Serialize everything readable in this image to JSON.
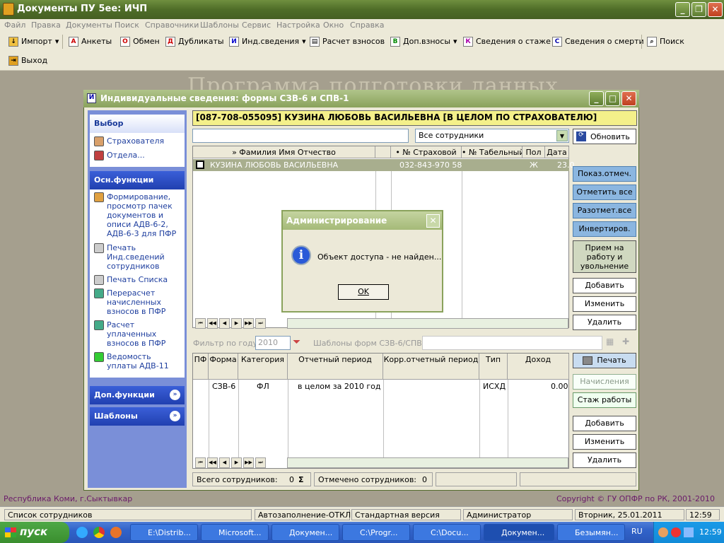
{
  "app": {
    "title": "Документы ПУ 5ее: ИЧП"
  },
  "menu": [
    "Файл",
    "Правка",
    "Документы",
    "Поиск",
    "Справочники",
    "Шаблоны",
    "Сервис",
    "Настройка",
    "Окно",
    "Справка"
  ],
  "toolbar": {
    "import": "Импорт",
    "ankety": "Анкеты",
    "obmen": "Обмен",
    "dublikaty": "Дубликаты",
    "ind": "Инд.сведения",
    "raschet": "Расчет взносов",
    "dopvz": "Доп.взносы",
    "stazh": "Сведения о стаже",
    "smerti": "Сведения о смерти",
    "poisk": "Поиск",
    "exit": "Выход"
  },
  "bgtext": "Программа подготовки данных",
  "window": {
    "title": "Индивидуальные сведения: формы СЗВ-6 и СПВ-1",
    "header": "[087-708-055095] КУЗИНА ЛЮБОВЬ ВАСИЛЬЕВНА [В ЦЕЛОМ ПО СТРАХОВАТЕЛЮ]",
    "filter_select": "Все сотрудники",
    "refresh": "Обновить"
  },
  "sidebar": {
    "vybor": "Выбор",
    "strah": "Страхователя",
    "otdela": "Отдела...",
    "osn": "Осн.функции",
    "f1": "Формирование, просмотр пачек документов и описи АДВ-6-2, АДВ-6-3 для ПФР",
    "f2": "Печать Инд.сведений сотрудников",
    "f3": "Печать Списка",
    "f4": "Перерасчет начисленных взносов в ПФР",
    "f5": "Расчет уплаченных взносов в ПФР",
    "f6": "Ведомость уплаты АДВ-11",
    "dop": "Доп.функции",
    "shabl": "Шаблоны"
  },
  "grid1": {
    "headers": [
      "» Фамилия Имя Отчество",
      "• № Страховой",
      "• № Табельный",
      "Пол",
      "Дата"
    ],
    "row": {
      "name": "КУЗИНА ЛЮБОВЬ ВАСИЛЬЕВНА",
      "snils": "032-843-970 58",
      "tab": "",
      "sex": "Ж",
      "date": "23.0"
    }
  },
  "right1": [
    "Показ.отмеч.",
    "Отметить все",
    "Разотмет.все",
    "Инвертиров.",
    "Прием на работу и увольнение",
    "Добавить",
    "Изменить",
    "Удалить"
  ],
  "filter": {
    "label": "Фильтр по году:",
    "year": "2010",
    "templates": "Шаблоны форм СЗВ-6/СПВ-1:"
  },
  "grid2": {
    "headers": [
      "ПФ",
      "Форма",
      "Категория",
      "Отчетный период",
      "Корр.отчетный период",
      "Тип",
      "Доход"
    ],
    "row": {
      "pf": "",
      "form": "СЗВ-6",
      "cat": "ФЛ",
      "period": "в целом за 2010 год",
      "corr": "",
      "type": "ИСХД",
      "income": "0.00"
    }
  },
  "right2": [
    "Печать",
    "Начисления",
    "Стаж работы",
    "Добавить",
    "Изменить",
    "Удалить"
  ],
  "bottom": {
    "total_label": "Всего сотрудников:",
    "total": "0",
    "sigma": "Σ",
    "marked_label": "Отмечено сотрудников:",
    "marked": "0"
  },
  "dialog": {
    "title": "Администрирование",
    "message": "Объект доступа - не найден...",
    "ok": "OK"
  },
  "footer": {
    "left": "Республика Коми, г.Сыктывкар",
    "right": "Copyright © ГУ ОПФР по РК, 2001-2010"
  },
  "status": [
    "Список сотрудников",
    "Автозаполнение-ОТКЛ",
    "Стандартная версия",
    "Администратор",
    "Вторник, 25.01.2011",
    "12:59"
  ],
  "taskbar": {
    "start": "пуск",
    "tasks": [
      "E:\\Distrib...",
      "Microsoft...",
      "Докумен...",
      "C:\\Progr...",
      "C:\\Docu...",
      "Докумен...",
      "Безымян..."
    ],
    "lang": "RU",
    "clock": "12:59"
  }
}
